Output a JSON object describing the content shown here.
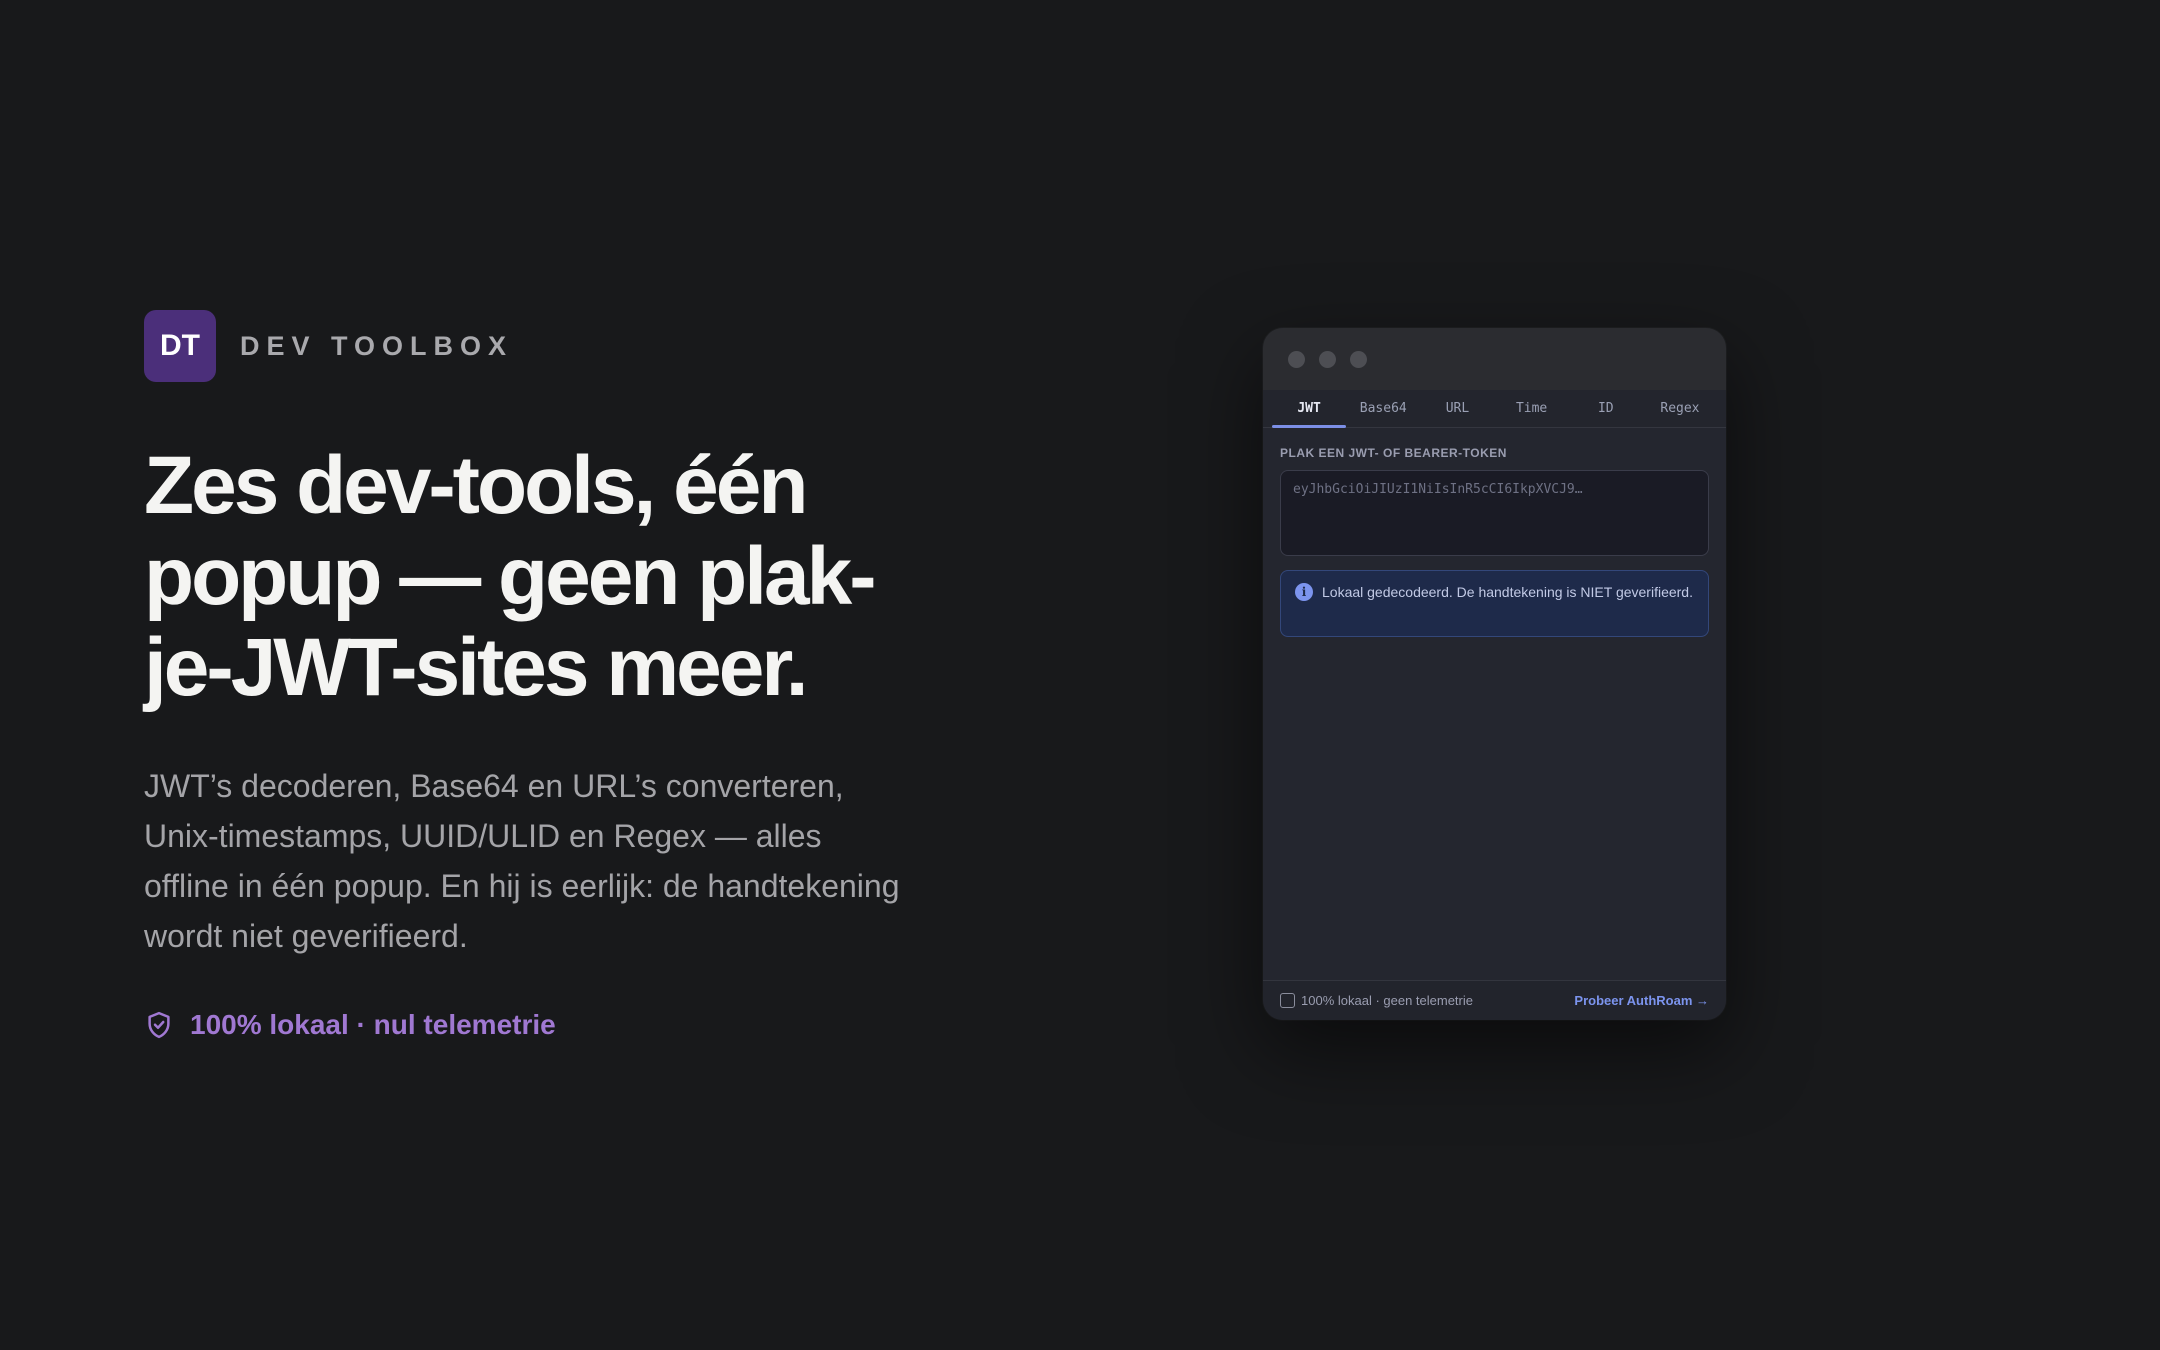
{
  "brand": {
    "logo_text": "DT",
    "name": "DEV TOOLBOX"
  },
  "hero": {
    "headline": "Zes dev-tools, één popup — geen plak-je-JWT-sites meer.",
    "subtext": "JWT’s decoderen, Base64 en URL’s converteren, Unix-timestamps, UUID/ULID en Regex — alles offline in één popup. En hij is eerlijk: de handtekening wordt niet geverifieerd.",
    "trust_icon": "shield-check-icon",
    "trust_text": "100% lokaal · nul telemetrie"
  },
  "popup": {
    "tabs": [
      {
        "label": "JWT",
        "active": true
      },
      {
        "label": "Base64",
        "active": false
      },
      {
        "label": "URL",
        "active": false
      },
      {
        "label": "Time",
        "active": false
      },
      {
        "label": "ID",
        "active": false
      },
      {
        "label": "Regex",
        "active": false
      }
    ],
    "field_label": "PLAK EEN JWT- OF BEARER-TOKEN",
    "token_placeholder": "eyJhbGciOiJIUzI1NiIsInR5cCI6IkpXVCJ9…",
    "notice_icon": "info-icon",
    "notice_text": "Lokaal gedecodeerd. De handtekening is NIET geverifieerd.",
    "footer": {
      "text": "100% lokaal · geen telemetrie",
      "link": "Probeer AuthRoam →"
    }
  },
  "colors": {
    "background": "#18191b",
    "brand_purple": "#4b2f7a",
    "trust_accent": "#a078d2",
    "tab_accent": "#7c8fe6",
    "notice_bg": "#1e2a4a"
  }
}
